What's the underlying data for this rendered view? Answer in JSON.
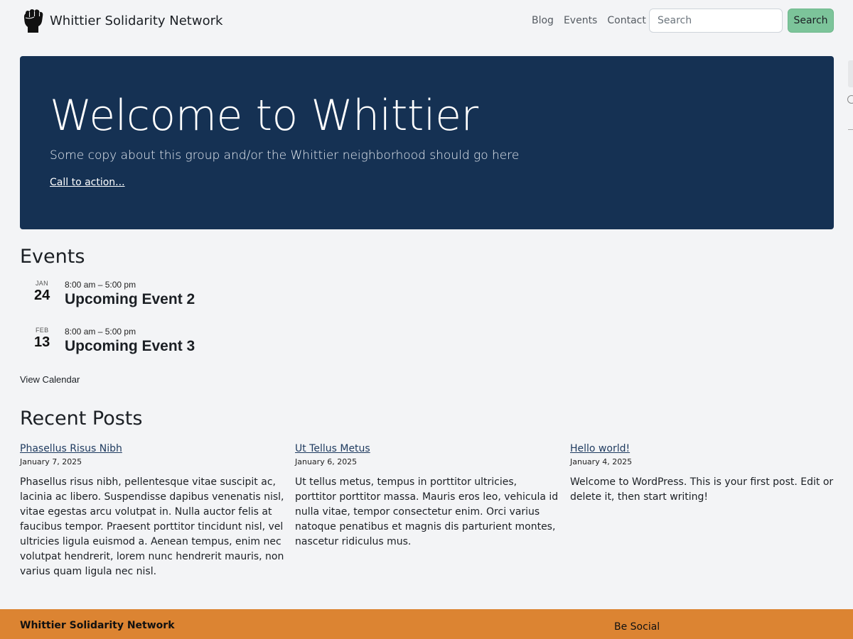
{
  "header": {
    "site_name": "Whittier Solidarity Network",
    "logo_icon": "raised-fist-icon",
    "nav": [
      {
        "label": "Blog"
      },
      {
        "label": "Events"
      },
      {
        "label": "Contact"
      }
    ],
    "search": {
      "placeholder": "Search",
      "button_label": "Search"
    }
  },
  "hero": {
    "title": "Welcome to Whittier",
    "copy": "Some copy about this group and/or the Whittier neighborhood should go here",
    "cta": "Call to action...",
    "background_color": "#153153"
  },
  "events": {
    "heading": "Events",
    "items": [
      {
        "month": "JAN",
        "day": "24",
        "time": "8:00 am – 5:00 pm",
        "title": "Upcoming Event 2"
      },
      {
        "month": "FEB",
        "day": "13",
        "time": "8:00 am – 5:00 pm",
        "title": "Upcoming Event 3"
      }
    ],
    "view_calendar": "View Calendar"
  },
  "recent_posts": {
    "heading": "Recent Posts",
    "items": [
      {
        "title": "Phasellus Risus Nibh",
        "date": "January 7, 2025",
        "excerpt": "Phasellus risus nibh, pellentesque vitae suscipit ac, lacinia ac libero. Suspendisse dapibus venenatis nisl, vitae egestas arcu volutpat in. Nulla auctor felis at faucibus tempor. Praesent porttitor tincidunt nisl, vel ultricies ligula euismod a. Aenean tempus, enim nec volutpat hendrerit, lorem nunc hendrerit mauris, non varius quam ligula nec nisl."
      },
      {
        "title": "Ut Tellus Metus",
        "date": "January 6, 2025",
        "excerpt": "Ut tellus metus, tempus in porttitor ultricies, porttitor porttitor massa. Mauris eros leo, vehicula id nulla vitae, tempor consectetur enim. Orci varius natoque penatibus et magnis dis parturient montes, nascetur ridiculus mus."
      },
      {
        "title": "Hello world!",
        "date": "January 4, 2025",
        "excerpt": "Welcome to WordPress. This is your first post. Edit or delete it, then start writing!"
      }
    ]
  },
  "footer": {
    "site_name": "Whittier Solidarity Network",
    "social_heading": "Be Social",
    "background_color": "#dc8432"
  },
  "colors": {
    "accent_button": "#7cc49a",
    "page_background": "#f3f4f6"
  }
}
